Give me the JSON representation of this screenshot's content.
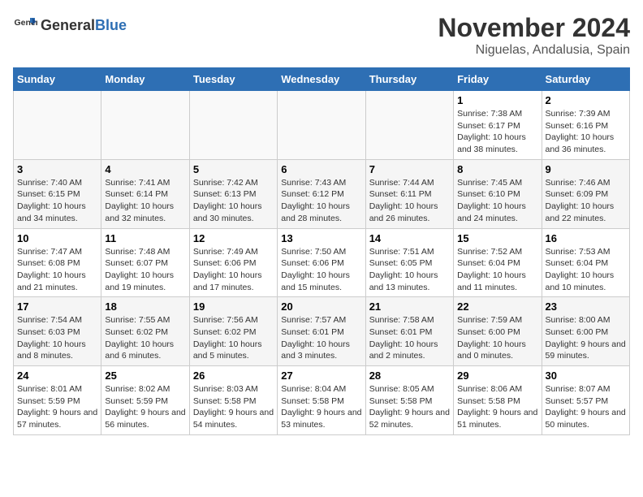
{
  "logo": {
    "general": "General",
    "blue": "Blue"
  },
  "title": "November 2024",
  "location": "Niguelas, Andalusia, Spain",
  "weekdays": [
    "Sunday",
    "Monday",
    "Tuesday",
    "Wednesday",
    "Thursday",
    "Friday",
    "Saturday"
  ],
  "weeks": [
    [
      {
        "day": "",
        "info": ""
      },
      {
        "day": "",
        "info": ""
      },
      {
        "day": "",
        "info": ""
      },
      {
        "day": "",
        "info": ""
      },
      {
        "day": "",
        "info": ""
      },
      {
        "day": "1",
        "info": "Sunrise: 7:38 AM\nSunset: 6:17 PM\nDaylight: 10 hours and 38 minutes."
      },
      {
        "day": "2",
        "info": "Sunrise: 7:39 AM\nSunset: 6:16 PM\nDaylight: 10 hours and 36 minutes."
      }
    ],
    [
      {
        "day": "3",
        "info": "Sunrise: 7:40 AM\nSunset: 6:15 PM\nDaylight: 10 hours and 34 minutes."
      },
      {
        "day": "4",
        "info": "Sunrise: 7:41 AM\nSunset: 6:14 PM\nDaylight: 10 hours and 32 minutes."
      },
      {
        "day": "5",
        "info": "Sunrise: 7:42 AM\nSunset: 6:13 PM\nDaylight: 10 hours and 30 minutes."
      },
      {
        "day": "6",
        "info": "Sunrise: 7:43 AM\nSunset: 6:12 PM\nDaylight: 10 hours and 28 minutes."
      },
      {
        "day": "7",
        "info": "Sunrise: 7:44 AM\nSunset: 6:11 PM\nDaylight: 10 hours and 26 minutes."
      },
      {
        "day": "8",
        "info": "Sunrise: 7:45 AM\nSunset: 6:10 PM\nDaylight: 10 hours and 24 minutes."
      },
      {
        "day": "9",
        "info": "Sunrise: 7:46 AM\nSunset: 6:09 PM\nDaylight: 10 hours and 22 minutes."
      }
    ],
    [
      {
        "day": "10",
        "info": "Sunrise: 7:47 AM\nSunset: 6:08 PM\nDaylight: 10 hours and 21 minutes."
      },
      {
        "day": "11",
        "info": "Sunrise: 7:48 AM\nSunset: 6:07 PM\nDaylight: 10 hours and 19 minutes."
      },
      {
        "day": "12",
        "info": "Sunrise: 7:49 AM\nSunset: 6:06 PM\nDaylight: 10 hours and 17 minutes."
      },
      {
        "day": "13",
        "info": "Sunrise: 7:50 AM\nSunset: 6:06 PM\nDaylight: 10 hours and 15 minutes."
      },
      {
        "day": "14",
        "info": "Sunrise: 7:51 AM\nSunset: 6:05 PM\nDaylight: 10 hours and 13 minutes."
      },
      {
        "day": "15",
        "info": "Sunrise: 7:52 AM\nSunset: 6:04 PM\nDaylight: 10 hours and 11 minutes."
      },
      {
        "day": "16",
        "info": "Sunrise: 7:53 AM\nSunset: 6:04 PM\nDaylight: 10 hours and 10 minutes."
      }
    ],
    [
      {
        "day": "17",
        "info": "Sunrise: 7:54 AM\nSunset: 6:03 PM\nDaylight: 10 hours and 8 minutes."
      },
      {
        "day": "18",
        "info": "Sunrise: 7:55 AM\nSunset: 6:02 PM\nDaylight: 10 hours and 6 minutes."
      },
      {
        "day": "19",
        "info": "Sunrise: 7:56 AM\nSunset: 6:02 PM\nDaylight: 10 hours and 5 minutes."
      },
      {
        "day": "20",
        "info": "Sunrise: 7:57 AM\nSunset: 6:01 PM\nDaylight: 10 hours and 3 minutes."
      },
      {
        "day": "21",
        "info": "Sunrise: 7:58 AM\nSunset: 6:01 PM\nDaylight: 10 hours and 2 minutes."
      },
      {
        "day": "22",
        "info": "Sunrise: 7:59 AM\nSunset: 6:00 PM\nDaylight: 10 hours and 0 minutes."
      },
      {
        "day": "23",
        "info": "Sunrise: 8:00 AM\nSunset: 6:00 PM\nDaylight: 9 hours and 59 minutes."
      }
    ],
    [
      {
        "day": "24",
        "info": "Sunrise: 8:01 AM\nSunset: 5:59 PM\nDaylight: 9 hours and 57 minutes."
      },
      {
        "day": "25",
        "info": "Sunrise: 8:02 AM\nSunset: 5:59 PM\nDaylight: 9 hours and 56 minutes."
      },
      {
        "day": "26",
        "info": "Sunrise: 8:03 AM\nSunset: 5:58 PM\nDaylight: 9 hours and 54 minutes."
      },
      {
        "day": "27",
        "info": "Sunrise: 8:04 AM\nSunset: 5:58 PM\nDaylight: 9 hours and 53 minutes."
      },
      {
        "day": "28",
        "info": "Sunrise: 8:05 AM\nSunset: 5:58 PM\nDaylight: 9 hours and 52 minutes."
      },
      {
        "day": "29",
        "info": "Sunrise: 8:06 AM\nSunset: 5:58 PM\nDaylight: 9 hours and 51 minutes."
      },
      {
        "day": "30",
        "info": "Sunrise: 8:07 AM\nSunset: 5:57 PM\nDaylight: 9 hours and 50 minutes."
      }
    ]
  ]
}
